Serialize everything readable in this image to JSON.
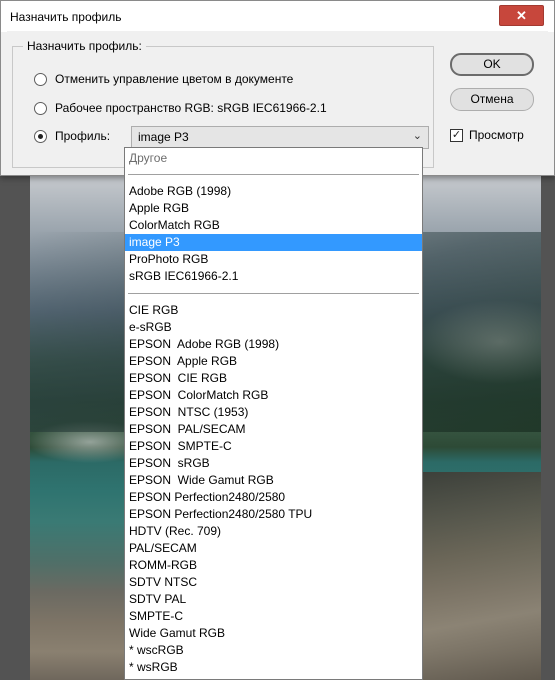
{
  "dialog": {
    "title": "Назначить профиль",
    "close_symbol": "✕",
    "group_label": "Назначить профиль:",
    "options": [
      {
        "label": "Отменить управление цветом в документе",
        "checked": false
      },
      {
        "label": "Рабочее пространство RGB:  sRGB IEC61966-2.1",
        "checked": false
      },
      {
        "label": "Профиль:",
        "checked": true
      }
    ],
    "profile_value": "image P3",
    "ok_label": "OK",
    "cancel_label": "Отмена",
    "preview_label": "Просмотр",
    "preview_checked": true
  },
  "dropdown": {
    "header": "Другое",
    "group1": [
      "Adobe RGB (1998)",
      "Apple RGB",
      "ColorMatch RGB",
      "image P3",
      "ProPhoto RGB",
      "sRGB IEC61966-2.1"
    ],
    "selected": "image P3",
    "group2": [
      "CIE RGB",
      "e-sRGB",
      "EPSON  Adobe RGB (1998)",
      "EPSON  Apple RGB",
      "EPSON  CIE RGB",
      "EPSON  ColorMatch RGB",
      "EPSON  NTSC (1953)",
      "EPSON  PAL/SECAM",
      "EPSON  SMPTE-C",
      "EPSON  sRGB",
      "EPSON  Wide Gamut RGB",
      "EPSON Perfection2480/2580",
      "EPSON Perfection2480/2580 TPU",
      "HDTV (Rec. 709)",
      "PAL/SECAM",
      "ROMM-RGB",
      "SDTV NTSC",
      "SDTV PAL",
      "SMPTE-C",
      "Wide Gamut RGB",
      "* wscRGB",
      "* wsRGB"
    ]
  },
  "colors": {
    "selection": "#3399ff",
    "dialog_bg": "#f0f0f0",
    "close_button": "#c7473c"
  }
}
